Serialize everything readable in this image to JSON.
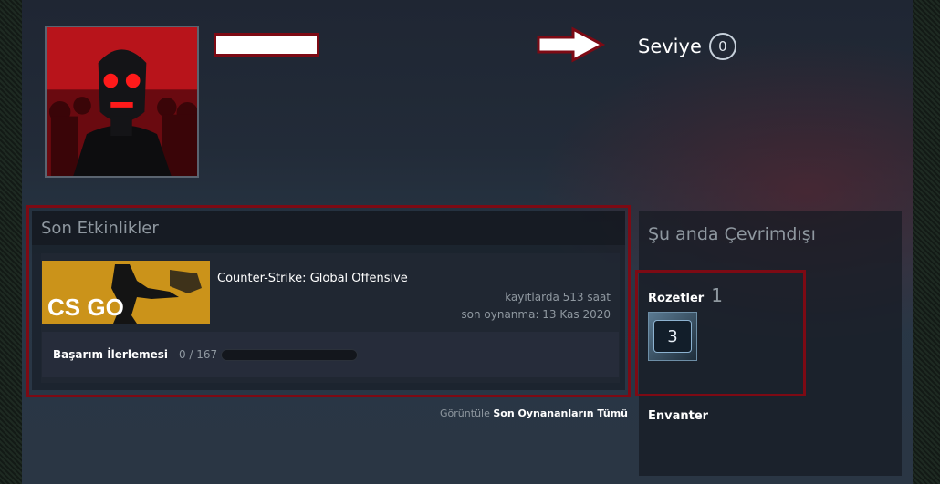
{
  "profile": {
    "level_label": "Seviye",
    "level_value": "0"
  },
  "activity": {
    "title": "Son Etkinlikler",
    "game": {
      "name": "Counter-Strike: Global Offensive",
      "hours": "kayıtlarda 513 saat",
      "last_played": "son oynanma: 13 Kas 2020",
      "logo_text": "CS GO",
      "achievement_label": "Başarım İlerlemesi",
      "achievement_count": "0 / 167",
      "achievement_progress": 0
    },
    "view_all_prefix": "Görüntüle",
    "view_all_link": "Son Oynananların Tümü"
  },
  "sidebar": {
    "status": "Şu anda Çevrimdışı",
    "badges_label": "Rozetler",
    "badges_count": "1",
    "badge_level": "3",
    "inventory_label": "Envanter"
  },
  "colors": {
    "highlight_outline": "#7d0a14",
    "avatar_red": "#b8141b",
    "muted_text": "#8f98a0"
  }
}
